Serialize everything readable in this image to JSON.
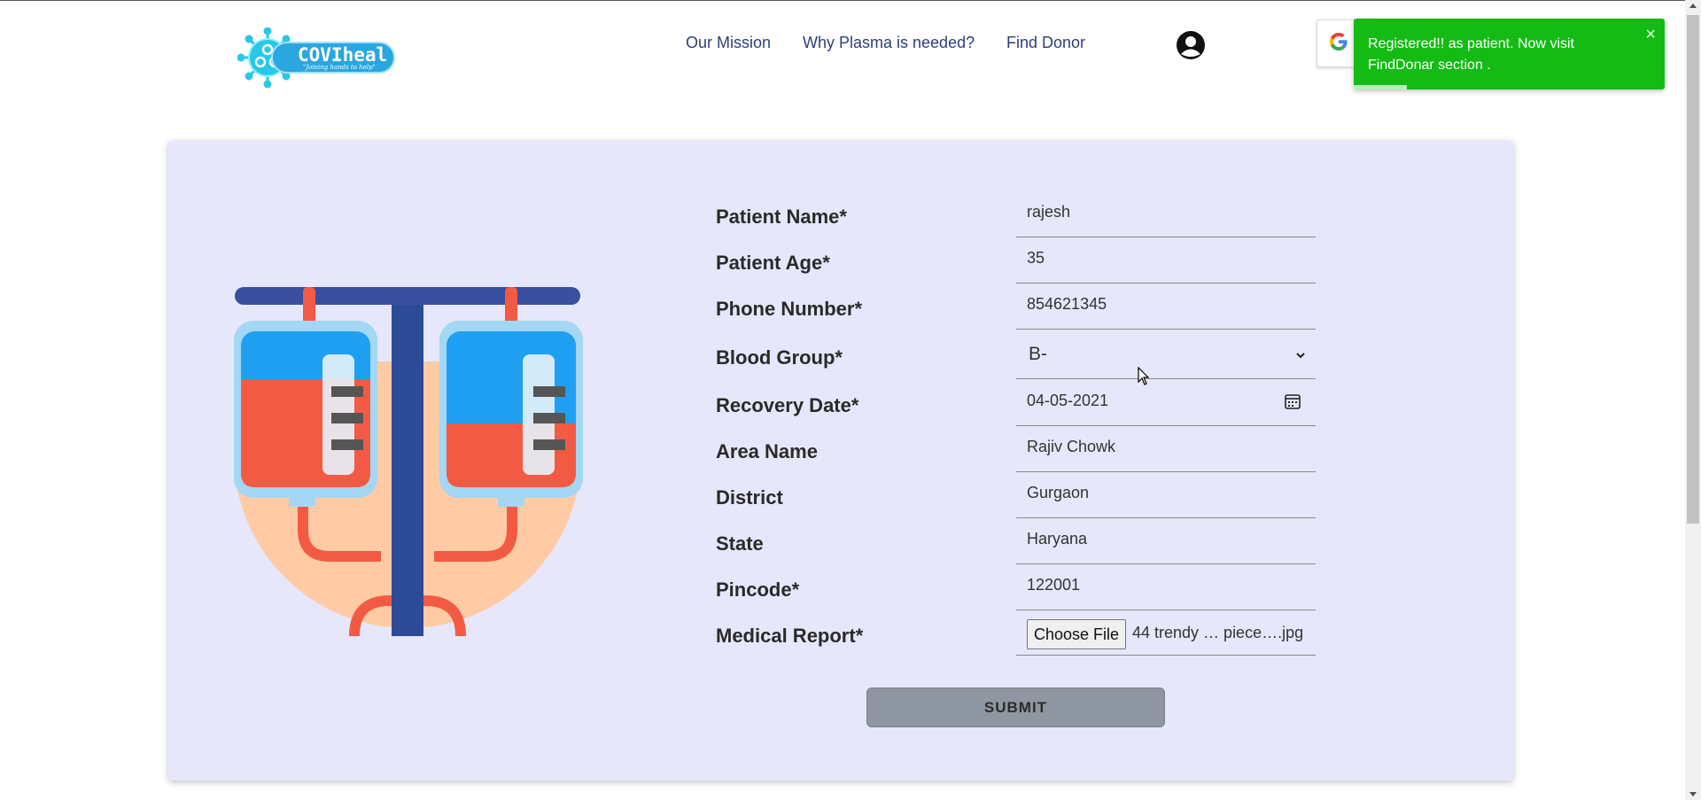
{
  "header": {
    "logo_text": "COVIheal",
    "logo_tagline": "\"Joining hands to help\"",
    "nav": [
      {
        "label": "Our Mission"
      },
      {
        "label": "Why Plasma is needed?"
      },
      {
        "label": "Find Donor"
      }
    ],
    "google_letter": "G"
  },
  "toast": {
    "message": "Registered!! as patient. Now visit FindDonar section .",
    "close": "×",
    "color": "#15bb15"
  },
  "form": {
    "patient_name": {
      "label": "Patient Name*",
      "value": "rajesh"
    },
    "patient_age": {
      "label": "Patient Age*",
      "value": "35"
    },
    "phone": {
      "label": "Phone Number*",
      "value": "854621345"
    },
    "blood_group": {
      "label": "Blood Group*",
      "value": "B-"
    },
    "recovery_date": {
      "label": "Recovery Date*",
      "value": "04-05-2021"
    },
    "area": {
      "label": "Area Name",
      "value": "Rajiv Chowk"
    },
    "district": {
      "label": "District",
      "value": "Gurgaon"
    },
    "state": {
      "label": "State",
      "value": "Haryana"
    },
    "pincode": {
      "label": "Pincode*",
      "value": "122001"
    },
    "medical_report": {
      "label": "Medical Report*",
      "button": "Choose File",
      "file": "44 trendy … piece….jpg"
    },
    "submit": "SUBMIT"
  },
  "colors": {
    "card_bg": "#e6e7fa",
    "nav_text": "#2c3e7a",
    "submit_bg": "#8e96a1"
  }
}
